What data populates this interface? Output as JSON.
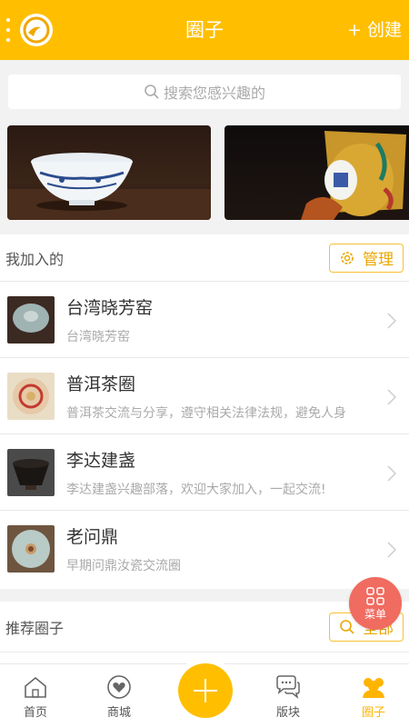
{
  "header": {
    "title": "圈子",
    "create_label": "+ 创建"
  },
  "search": {
    "placeholder": "搜索您感兴趣的"
  },
  "joined": {
    "title": "我加入的",
    "manage_label": "管理",
    "items": [
      {
        "name": "台湾晓芳窑",
        "desc": "台湾晓芳窑"
      },
      {
        "name": "普洱茶圈",
        "desc": "普洱茶交流与分享，遵守相关法律法规，避免人身"
      },
      {
        "name": "李达建盏",
        "desc": "李达建盏兴趣部落，欢迎大家加入，一起交流!"
      },
      {
        "name": "老问鼎",
        "desc": "早期问鼎汝瓷交流圈"
      }
    ]
  },
  "recommend": {
    "title": "推荐圈子",
    "all_label": "全部"
  },
  "fab": {
    "label": "菜单"
  },
  "tabs": [
    {
      "label": "首页",
      "icon": "home-icon"
    },
    {
      "label": "商城",
      "icon": "heart-icon"
    },
    {
      "label": "版块",
      "icon": "chat-icon"
    },
    {
      "label": "圈子",
      "icon": "group-icon",
      "active": true
    }
  ],
  "colors": {
    "accent": "#ffbf00",
    "fab": "#f06b60"
  }
}
